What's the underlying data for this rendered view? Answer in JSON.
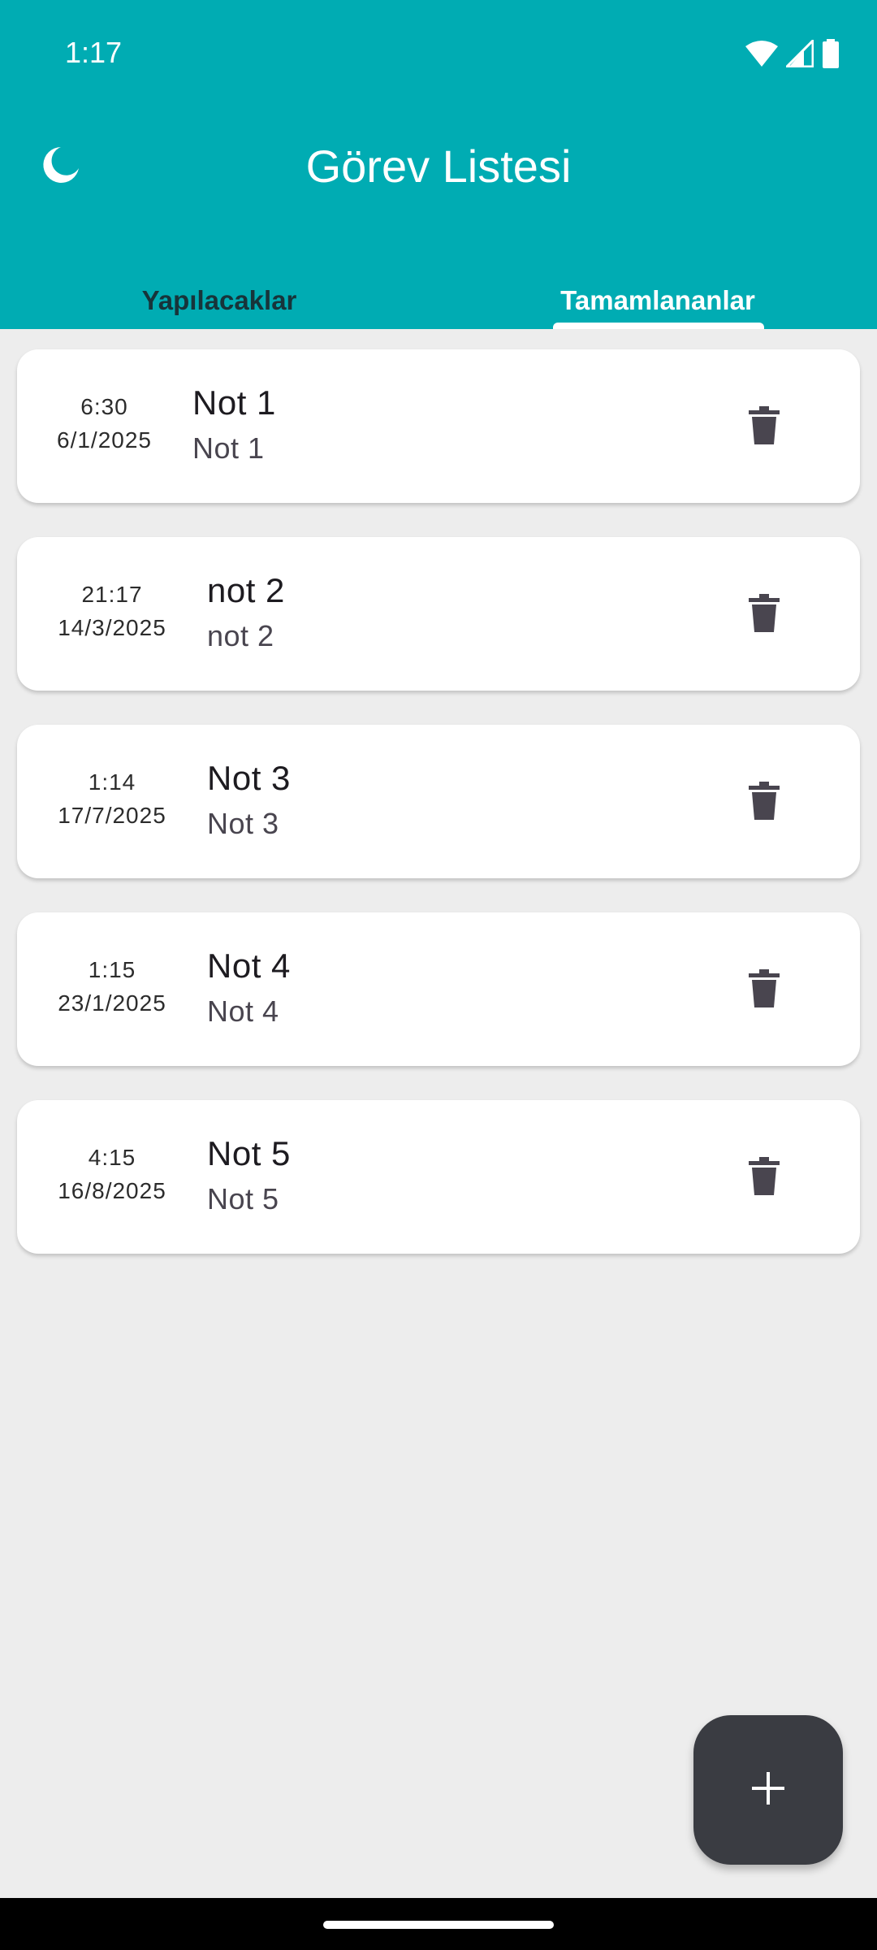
{
  "status_bar": {
    "time": "1:17",
    "icons": [
      "wifi-icon",
      "signal-icon",
      "battery-icon"
    ]
  },
  "header": {
    "title": "Görev Listesi",
    "theme_toggle_icon": "moon-icon",
    "background_color": "#00acb3"
  },
  "tabs": [
    {
      "label": "Yapılacaklar",
      "selected": false
    },
    {
      "label": "Tamamlananlar",
      "selected": true
    }
  ],
  "notes": [
    {
      "time": "6:30",
      "date": "6/1/2025",
      "title": "Not 1",
      "subtitle": "Not 1"
    },
    {
      "time": "21:17",
      "date": "14/3/2025",
      "title": "not 2",
      "subtitle": "not 2"
    },
    {
      "time": "1:14",
      "date": "17/7/2025",
      "title": "Not 3",
      "subtitle": "Not 3"
    },
    {
      "time": "1:15",
      "date": "23/1/2025",
      "title": "Not 4",
      "subtitle": "Not 4"
    },
    {
      "time": "4:15",
      "date": "16/8/2025",
      "title": "Not 5",
      "subtitle": "Not 5"
    }
  ],
  "item_action_icon": "trash-icon",
  "fab": {
    "icon": "plus-icon",
    "color": "#3a3c42"
  }
}
